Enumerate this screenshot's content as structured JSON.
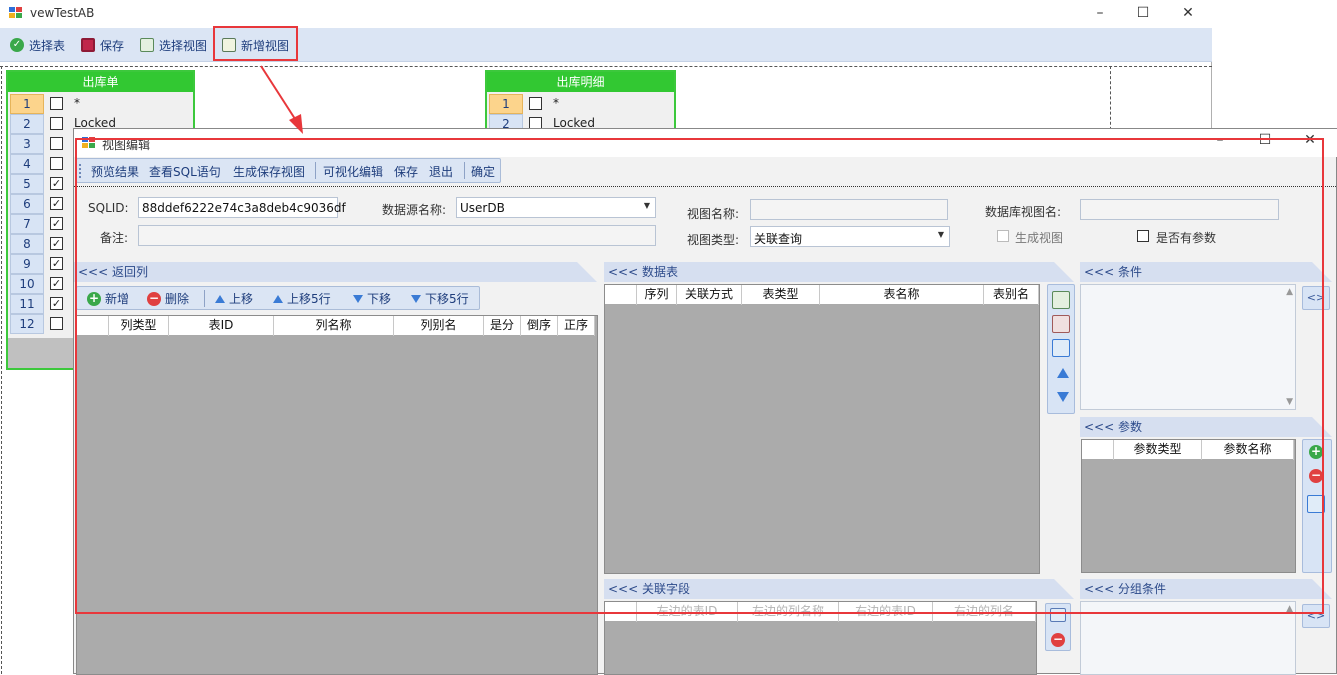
{
  "main": {
    "title": "vewTestAB",
    "toolbar": [
      {
        "label": "选择表",
        "icon": "check-circle-icon"
      },
      {
        "label": "保存",
        "icon": "save-icon"
      },
      {
        "label": "选择视图",
        "icon": "select-view-icon"
      },
      {
        "label": "新增视图",
        "icon": "add-view-icon"
      }
    ],
    "tables": [
      {
        "title": "出库单",
        "rows": [
          {
            "num": "1",
            "checked": "",
            "text": "*"
          },
          {
            "num": "2",
            "checked": "",
            "text": "Locked"
          },
          {
            "num": "3",
            "checked": "",
            "text": ""
          },
          {
            "num": "4",
            "checked": "",
            "text": ""
          },
          {
            "num": "5",
            "checked": "✓",
            "text": ""
          },
          {
            "num": "6",
            "checked": "✓",
            "text": ""
          },
          {
            "num": "7",
            "checked": "✓",
            "text": ""
          },
          {
            "num": "8",
            "checked": "✓",
            "text": ""
          },
          {
            "num": "9",
            "checked": "✓",
            "text": ""
          },
          {
            "num": "10",
            "checked": "✓",
            "text": ""
          },
          {
            "num": "11",
            "checked": "✓",
            "text": ""
          },
          {
            "num": "12",
            "checked": "",
            "text": ""
          }
        ]
      },
      {
        "title": "出库明细",
        "rows": [
          {
            "num": "1",
            "checked": "",
            "text": "*"
          },
          {
            "num": "2",
            "checked": "",
            "text": "Locked"
          }
        ]
      }
    ]
  },
  "dialog": {
    "title": "视图编辑",
    "toolbar": [
      "预览结果",
      "查看SQL语句",
      "生成保存视图",
      "可视化编辑",
      "保存",
      "退出",
      "确定"
    ],
    "form": {
      "sqlid_label": "SQLID:",
      "sqlid_value": "88ddef6222e74c3a8deb4c9036df",
      "datasource_label": "数据源名称:",
      "datasource_value": "UserDB",
      "viewname_label": "视图名称:",
      "viewname_value": "",
      "dbviewname_label": "数据库视图名:",
      "dbviewname_value": "",
      "remark_label": "备注:",
      "remark_value": "",
      "viewtype_label": "视图类型:",
      "viewtype_value": "关联查询",
      "generate_view_label": "生成视图",
      "has_params_label": "是否有参数"
    },
    "return_cols": {
      "header": "<<< 返回列",
      "toolbar": [
        "新增",
        "删除",
        "上移",
        "上移5行",
        "下移",
        "下移5行"
      ],
      "columns": [
        "列类型",
        "表ID",
        "列名称",
        "列别名",
        "是分",
        "倒序",
        "正序"
      ]
    },
    "datatable": {
      "header": "<<< 数据表",
      "columns": [
        "序列",
        "关联方式",
        "表类型",
        "表名称",
        "表别名"
      ]
    },
    "conditions": {
      "header": "<<< 条件",
      "toggle": "<>"
    },
    "params": {
      "header": "<<< 参数",
      "columns": [
        "参数类型",
        "参数名称"
      ]
    },
    "join_fields": {
      "header": "<<< 关联字段",
      "columns": [
        "左边的表ID",
        "左边的列名称",
        "右边的表ID",
        "右边的列名"
      ]
    },
    "group": {
      "header": "<<< 分组条件",
      "toggle": "<>"
    }
  },
  "annotation": {
    "color": "#e8373b"
  }
}
